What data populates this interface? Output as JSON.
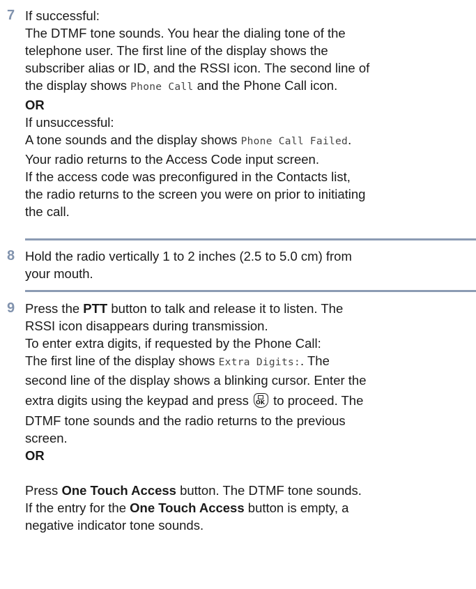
{
  "step7": {
    "number": "7",
    "if_successful": "If successful:",
    "success_line1": "The DTMF tone sounds. You hear the dialing tone of the",
    "success_line2": "telephone user. The first line of the display shows the",
    "success_line3": "subscriber alias or ID, and the RSSI icon. The second line of",
    "success_line4_pre": "the display shows ",
    "success_line4_mono": "Phone Call",
    "success_line4_post": " and the Phone Call icon.",
    "or": "OR",
    "if_unsuccessful": "If unsuccessful:",
    "fail_line1_pre": "A tone sounds and the display shows ",
    "fail_line1_mono": "Phone Call Failed",
    "fail_line1_post": ".",
    "fail_line2": "Your radio returns to the Access Code input screen.",
    "fail_line3": "If the access code was preconfigured in the Contacts list,",
    "fail_line4": "the radio returns to the screen you were on prior to initiating",
    "fail_line5": "the call."
  },
  "step8": {
    "number": "8",
    "line1": "Hold the radio vertically 1 to 2 inches (2.5 to 5.0 cm) from",
    "line2": "your mouth."
  },
  "step9": {
    "number": "9",
    "line1_pre": "Press the ",
    "line1_bold": "PTT",
    "line1_post": " button to talk and release it to listen. The",
    "line2": "RSSI icon disappears during transmission.",
    "line3": "To enter extra digits, if requested by the Phone Call:",
    "line4_pre": "The first line of the display shows ",
    "line4_mono": "Extra Digits:",
    "line4_post": ". The",
    "line5": "second line of the display shows a blinking cursor. Enter the",
    "line6_pre": "extra digits using the keypad and press ",
    "ok_key_label": "OK",
    "line6_post": " to proceed. The",
    "line7": "DTMF tone sounds and the radio returns to the previous",
    "line8": "screen.",
    "or": "OR",
    "line9_pre": "Press ",
    "line9_bold": "One Touch Access",
    "line9_post": " button. The DTMF tone sounds.",
    "line10_pre": "If the entry for the ",
    "line10_bold": "One Touch Access",
    "line10_post": " button is empty, a",
    "line11": "negative indicator tone sounds."
  }
}
